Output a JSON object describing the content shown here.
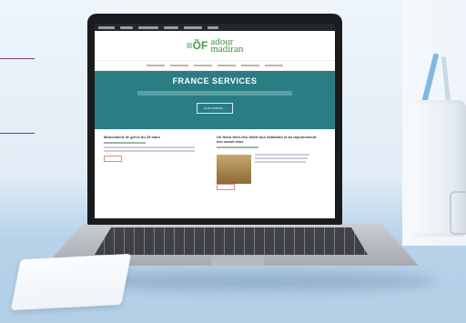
{
  "website": {
    "logo": {
      "mark": "≡ÕF",
      "name_line1": "adour",
      "name_line2": "madiran"
    },
    "hero": {
      "title": "FRANCE SERVICES",
      "button": "PLUS D'INFOS ..."
    },
    "cards": [
      {
        "title": "Mouvement de grève du 29 mars",
        "button": ""
      },
      {
        "title": "Un fictor tiers-lieu dédié aux habitants et au rayonnement des savoir-faire",
        "button": ""
      }
    ]
  }
}
